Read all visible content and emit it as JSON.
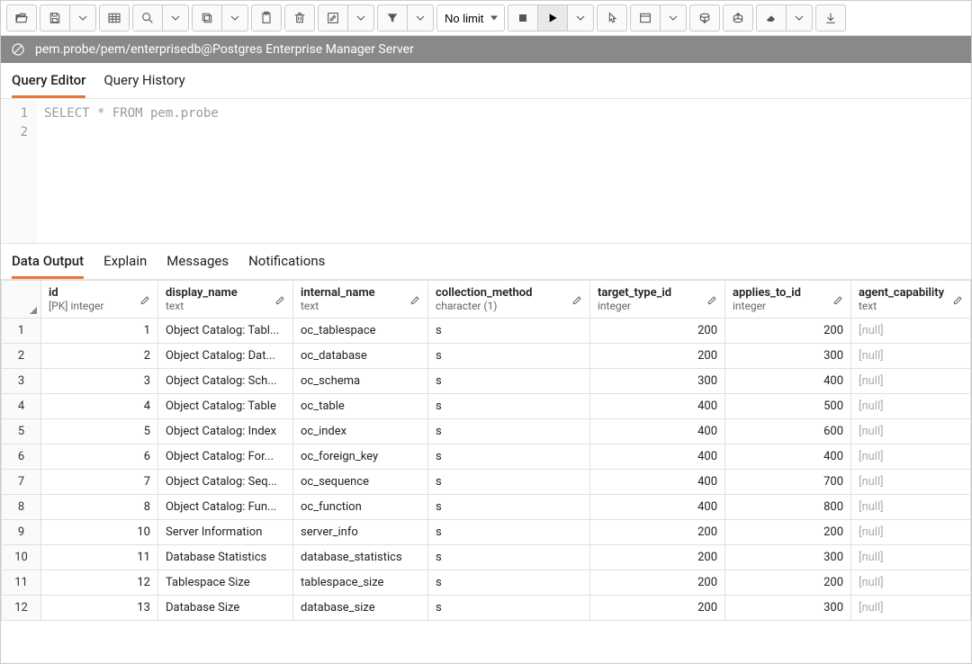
{
  "toolbar": {
    "limit_label": "No limit"
  },
  "titlebar": {
    "path": "pem.probe/pem/enterprisedb@Postgres Enterprise Manager Server"
  },
  "editor_tabs": {
    "query_editor": "Query Editor",
    "query_history": "Query History"
  },
  "editor": {
    "line1": "1",
    "line2": "2",
    "code": "SELECT * FROM pem.probe"
  },
  "output_tabs": {
    "data_output": "Data Output",
    "explain": "Explain",
    "messages": "Messages",
    "notifications": "Notifications"
  },
  "columns": [
    {
      "name": "id",
      "type": "[PK] integer"
    },
    {
      "name": "display_name",
      "type": "text"
    },
    {
      "name": "internal_name",
      "type": "text"
    },
    {
      "name": "collection_method",
      "type": "character (1)"
    },
    {
      "name": "target_type_id",
      "type": "integer"
    },
    {
      "name": "applies_to_id",
      "type": "integer"
    },
    {
      "name": "agent_capability",
      "type": "text"
    }
  ],
  "rows": [
    {
      "n": "1",
      "id": "1",
      "display_name": "Object Catalog: Tabl...",
      "internal_name": "oc_tablespace",
      "collection_method": "s",
      "target_type_id": "200",
      "applies_to_id": "200",
      "agent_capability": "[null]"
    },
    {
      "n": "2",
      "id": "2",
      "display_name": "Object Catalog: Dat...",
      "internal_name": "oc_database",
      "collection_method": "s",
      "target_type_id": "200",
      "applies_to_id": "300",
      "agent_capability": "[null]"
    },
    {
      "n": "3",
      "id": "3",
      "display_name": "Object Catalog: Sch...",
      "internal_name": "oc_schema",
      "collection_method": "s",
      "target_type_id": "300",
      "applies_to_id": "400",
      "agent_capability": "[null]"
    },
    {
      "n": "4",
      "id": "4",
      "display_name": "Object Catalog: Table",
      "internal_name": "oc_table",
      "collection_method": "s",
      "target_type_id": "400",
      "applies_to_id": "500",
      "agent_capability": "[null]"
    },
    {
      "n": "5",
      "id": "5",
      "display_name": "Object Catalog: Index",
      "internal_name": "oc_index",
      "collection_method": "s",
      "target_type_id": "400",
      "applies_to_id": "600",
      "agent_capability": "[null]"
    },
    {
      "n": "6",
      "id": "6",
      "display_name": "Object Catalog: For...",
      "internal_name": "oc_foreign_key",
      "collection_method": "s",
      "target_type_id": "400",
      "applies_to_id": "400",
      "agent_capability": "[null]"
    },
    {
      "n": "7",
      "id": "7",
      "display_name": "Object Catalog: Seq...",
      "internal_name": "oc_sequence",
      "collection_method": "s",
      "target_type_id": "400",
      "applies_to_id": "700",
      "agent_capability": "[null]"
    },
    {
      "n": "8",
      "id": "8",
      "display_name": "Object Catalog: Fun...",
      "internal_name": "oc_function",
      "collection_method": "s",
      "target_type_id": "400",
      "applies_to_id": "800",
      "agent_capability": "[null]"
    },
    {
      "n": "9",
      "id": "10",
      "display_name": "Server Information",
      "internal_name": "server_info",
      "collection_method": "s",
      "target_type_id": "200",
      "applies_to_id": "200",
      "agent_capability": "[null]"
    },
    {
      "n": "10",
      "id": "11",
      "display_name": "Database Statistics",
      "internal_name": "database_statistics",
      "collection_method": "s",
      "target_type_id": "200",
      "applies_to_id": "300",
      "agent_capability": "[null]"
    },
    {
      "n": "11",
      "id": "12",
      "display_name": "Tablespace Size",
      "internal_name": "tablespace_size",
      "collection_method": "s",
      "target_type_id": "200",
      "applies_to_id": "200",
      "agent_capability": "[null]"
    },
    {
      "n": "12",
      "id": "13",
      "display_name": "Database Size",
      "internal_name": "database_size",
      "collection_method": "s",
      "target_type_id": "200",
      "applies_to_id": "300",
      "agent_capability": "[null]"
    }
  ]
}
